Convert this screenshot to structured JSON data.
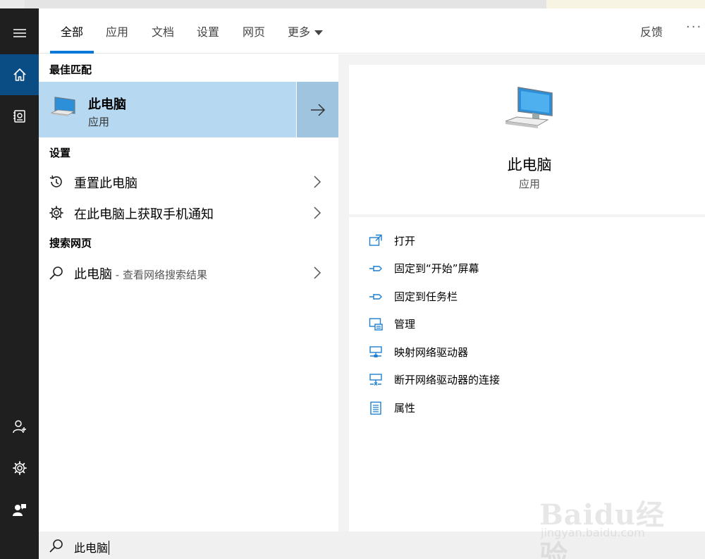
{
  "tabs": [
    {
      "label": "全部"
    },
    {
      "label": "应用"
    },
    {
      "label": "文档"
    },
    {
      "label": "设置"
    },
    {
      "label": "网页"
    },
    {
      "label": "更多"
    }
  ],
  "header": {
    "feedback": "反馈",
    "more_dots": "···"
  },
  "sections": {
    "best_match": "最佳匹配",
    "settings": "设置",
    "web": "搜索网页"
  },
  "best": {
    "name": "此电脑",
    "type": "应用"
  },
  "settings_items": [
    {
      "label": "重置此电脑"
    },
    {
      "label": "在此电脑上获取手机通知"
    }
  ],
  "web_item": {
    "label": "此电脑",
    "hint": " - 查看网络搜索结果"
  },
  "detail": {
    "name": "此电脑",
    "type": "应用"
  },
  "actions": [
    {
      "label": "打开",
      "icon": "open-icon"
    },
    {
      "label": "固定到“开始”屏幕",
      "icon": "pin-icon"
    },
    {
      "label": "固定到任务栏",
      "icon": "pin-icon"
    },
    {
      "label": "管理",
      "icon": "manage-icon"
    },
    {
      "label": "映射网络驱动器",
      "icon": "network-drive-icon"
    },
    {
      "label": "断开网络驱动器的连接",
      "icon": "disconnect-drive-icon"
    },
    {
      "label": "属性",
      "icon": "properties-icon"
    }
  ],
  "search": {
    "query": "此电脑"
  },
  "watermark": {
    "brand": "Baidu经验",
    "url": "jingyan.baidu.com"
  },
  "colors": {
    "accent": "#0a78d7",
    "rail": "#1f1f1f",
    "rail_active": "#0a4d85",
    "best_bg": "#b6d8f1",
    "icon_blue": "#1e7fd1"
  }
}
